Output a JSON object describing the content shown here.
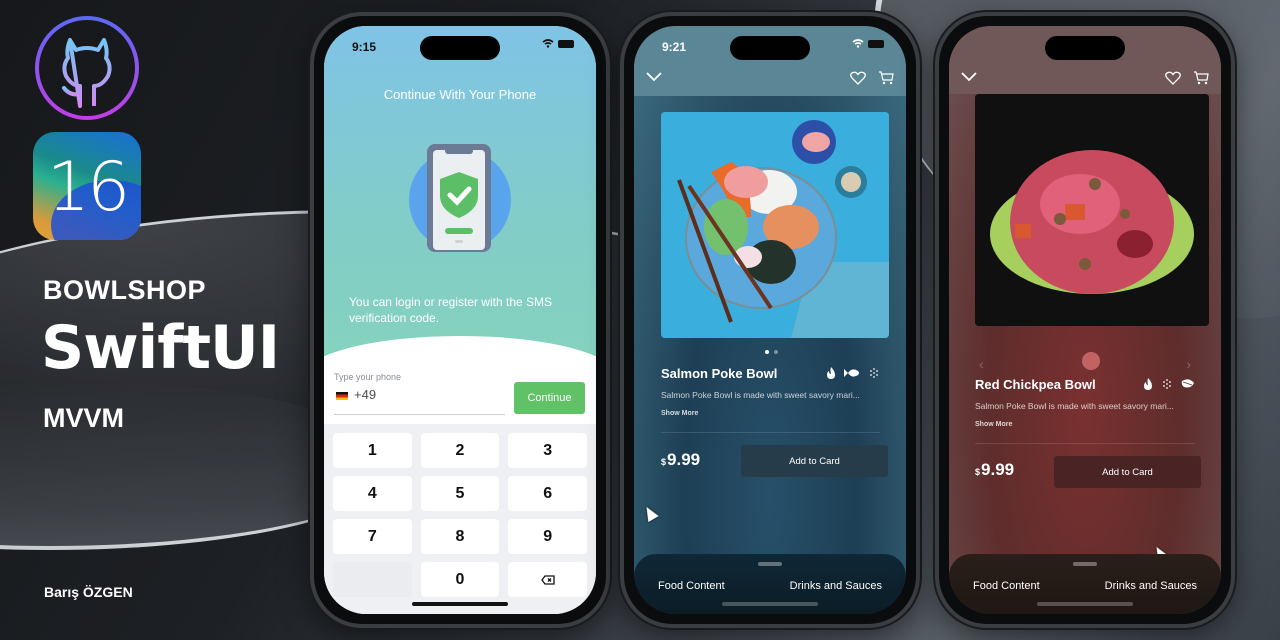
{
  "branding": {
    "app_name": "BOWLSHOP",
    "framework": "SwiftUI",
    "architecture": "MVVM",
    "author": "Barış ÖZGEN",
    "ios_version": "16",
    "github_icon": "github-octocat-icon"
  },
  "phone_login": {
    "status_time": "9:15",
    "title": "Continue With Your Phone",
    "description": "You can login or register with the SMS verification code.",
    "illustration": "phone-shield-check-icon",
    "phone_label": "Type your phone",
    "country_flag": "germany-flag",
    "country_code": "+49",
    "continue_label": "Continue",
    "continue_color": "#61c167",
    "keypad": [
      "1",
      "2",
      "3",
      "4",
      "5",
      "6",
      "7",
      "8",
      "9",
      "",
      "0",
      "⌫"
    ]
  },
  "phone_salmon": {
    "status_time": "9:21",
    "dish_name": "Salmon Poke Bowl",
    "description": "Salmon Poke Bowl is made with sweet savory mari...",
    "show_more": "Show More",
    "currency": "$",
    "price": "9.99",
    "add_label": "Add to Card",
    "attribute_icons": [
      "flame-icon",
      "fish-icon",
      "grain-icon"
    ],
    "image_page": 1,
    "image_pages": 2,
    "tabs": [
      "Food Content",
      "Drinks and Sauces"
    ]
  },
  "phone_chickpea": {
    "dish_name": "Red Chickpea Bowl",
    "description": "Salmon Poke Bowl is made with sweet savory mari...",
    "show_more": "Show More",
    "currency": "$",
    "price": "9.99",
    "add_label": "Add to Card",
    "attribute_icons": [
      "flame-icon",
      "grain-icon",
      "leaf-icon"
    ],
    "pager_prev": "‹",
    "pager_next": "›",
    "tabs": [
      "Food Content",
      "Drinks and Sauces"
    ]
  }
}
